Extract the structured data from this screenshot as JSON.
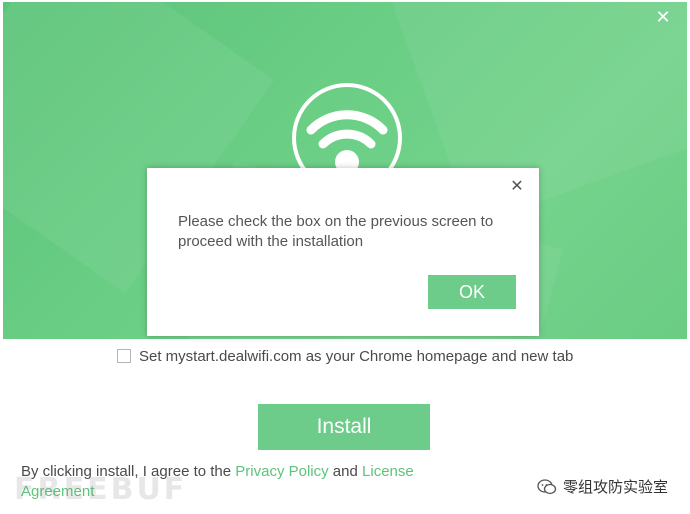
{
  "installer": {
    "close_glyph": "✕",
    "checkbox_label": "Set mystart.dealwifi.com as your Chrome homepage and new tab",
    "checkbox_checked": false,
    "install_label": "Install",
    "legal_prefix": "By clicking install, I agree to the ",
    "privacy_link": "Privacy Policy",
    "legal_mid": " and ",
    "license_link": "License Agreement"
  },
  "dialog": {
    "close_glyph": "✕",
    "message": "Please check the box on the previous screen to proceed with the installation",
    "ok_label": "OK"
  },
  "watermarks": {
    "left": "FREEBUF",
    "right": "零组攻防实验室"
  },
  "icons": [
    "close-icon",
    "wifi-icon",
    "checkbox-icon",
    "wechat-icon"
  ],
  "colors": {
    "brand_green": "#6ecc8a",
    "banner_green": "#6ccf86",
    "link_green": "#5cc47a",
    "text_gray": "#4a4a4a"
  }
}
